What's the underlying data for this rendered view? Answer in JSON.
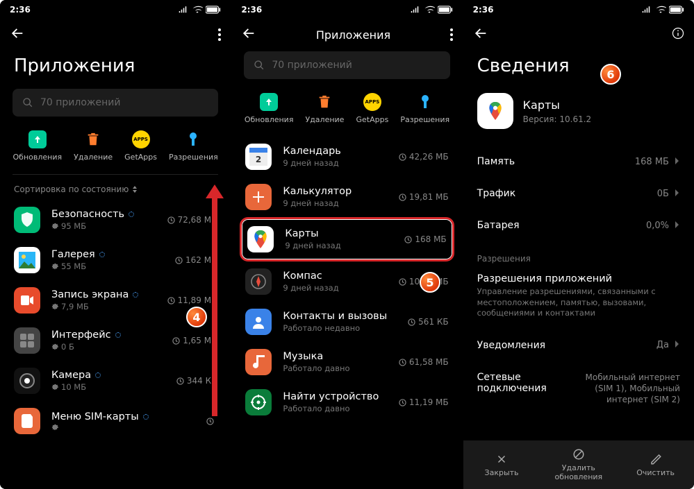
{
  "status": {
    "time": "2:36"
  },
  "screen1": {
    "title": "Приложения",
    "search_placeholder": "70 приложений",
    "actions": {
      "updates": "Обновления",
      "delete": "Удаление",
      "getapps": "GetApps",
      "perms": "Разрешения"
    },
    "sort_label": "Сортировка по состоянию",
    "apps": [
      {
        "name": "Безопасность",
        "info": "95 МБ",
        "right": "72,68 МБ",
        "ico_bg": "#0b7",
        "ico": "shield"
      },
      {
        "name": "Галерея",
        "info": "55 МБ",
        "right": "162 МБ",
        "ico_bg": "#fff",
        "ico": "gallery"
      },
      {
        "name": "Запись экрана",
        "info": "7,9 МБ",
        "right": "11,89 МБ",
        "ico_bg": "#e84b2c",
        "ico": "rec"
      },
      {
        "name": "Интерфейс",
        "info": "0 Б",
        "right": "1,65 МБ",
        "ico_bg": "#444",
        "ico": "ui"
      },
      {
        "name": "Камера",
        "info": "10 МБ",
        "right": "344 КБ",
        "ico_bg": "#111",
        "ico": "camera"
      },
      {
        "name": "Меню SIM-карты",
        "info": "",
        "right": "",
        "ico_bg": "#e8673a",
        "ico": "sim"
      }
    ]
  },
  "screen2": {
    "title": "Приложения",
    "search_placeholder": "70 приложений",
    "actions": {
      "updates": "Обновления",
      "delete": "Удаление",
      "getapps": "GetApps",
      "perms": "Разрешения"
    },
    "apps": [
      {
        "name": "Календарь",
        "info": "9 дней назад",
        "right": "42,26 МБ",
        "ico_bg": "#fff",
        "ico": "cal"
      },
      {
        "name": "Калькулятор",
        "info": "9 дней назад",
        "right": "19,81 МБ",
        "ico_bg": "#e8673a",
        "ico": "calc"
      },
      {
        "name": "Карты",
        "info": "9 дней назад",
        "right": "168 МБ",
        "ico_bg": "#fff",
        "ico": "maps",
        "hl": true
      },
      {
        "name": "Компас",
        "info": "9 дней назад",
        "right": "10,33 МБ",
        "ico_bg": "#222",
        "ico": "compass"
      },
      {
        "name": "Контакты и вызовы",
        "info": "Работало недавно",
        "right": "561 КБ",
        "ico_bg": "#3a82e8",
        "ico": "contact"
      },
      {
        "name": "Музыка",
        "info": "Работало давно",
        "right": "61,58 МБ",
        "ico_bg": "#e8673a",
        "ico": "music"
      },
      {
        "name": "Найти устройство",
        "info": "Работало давно",
        "right": "11,19 МБ",
        "ico_bg": "#0a7c3a",
        "ico": "find"
      }
    ]
  },
  "screen3": {
    "title": "Сведения",
    "app_name": "Карты",
    "app_version": "Версия: 10.61.2",
    "rows": {
      "memory": {
        "label": "Память",
        "value": "168 МБ"
      },
      "traffic": {
        "label": "Трафик",
        "value": "0Б"
      },
      "battery": {
        "label": "Батарея",
        "value": "0,0%"
      }
    },
    "perm_section": "Разрешения",
    "perm_title": "Разрешения приложений",
    "perm_desc": "Управление разрешениями, связанными с местоположением, памятью, вызовами, сообщениями и контактами",
    "notif": {
      "label": "Уведомления",
      "value": "Да"
    },
    "net": {
      "label": "Сетевые подключения",
      "value": "Мобильный интернет (SIM 1), Мобильный интернет (SIM 2)"
    },
    "bottom": {
      "close": "Закрыть",
      "uninstall": "Удалить обновления",
      "clear": "Очистить"
    }
  },
  "markers": {
    "m4": "4",
    "m5": "5",
    "m6": "6"
  }
}
